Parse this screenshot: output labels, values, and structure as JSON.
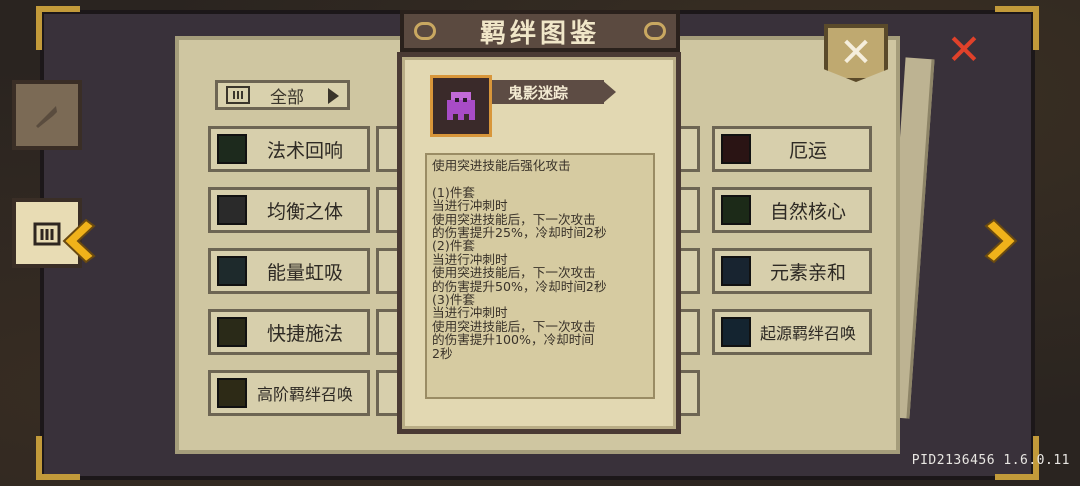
{
  "title": "羁绊图鉴",
  "filter": {
    "label": "全部"
  },
  "sets_left": [
    "法术回响",
    "均衡之体",
    "能量虹吸",
    "快捷施法",
    "高阶羁绊召唤"
  ],
  "sets_right": [
    "厄运",
    "自然核心",
    "元素亲和",
    "起源羁绊召唤"
  ],
  "popup": {
    "name": "鬼影迷踪",
    "description": "使用突进技能后强化攻击\n\n(1)件套\n当进行冲刺时\n使用突进技能后，下一次攻击\n的伤害提升25%，冷却时间2秒\n(2)件套\n当进行冲刺时\n使用突进技能后，下一次攻击\n的伤害提升50%，冷却时间2秒\n(3)件套\n当进行冲刺时\n使用突进技能后，下一次攻击\n的伤害提升100%，冷却时间\n2秒"
  },
  "close_symbol": "✕",
  "version_text": "PID2136456 1.6.0.11",
  "colors": {
    "accent_gold": "#f0b21a",
    "close_red": "#e0412a",
    "card_bg": "#e2d8b2"
  }
}
